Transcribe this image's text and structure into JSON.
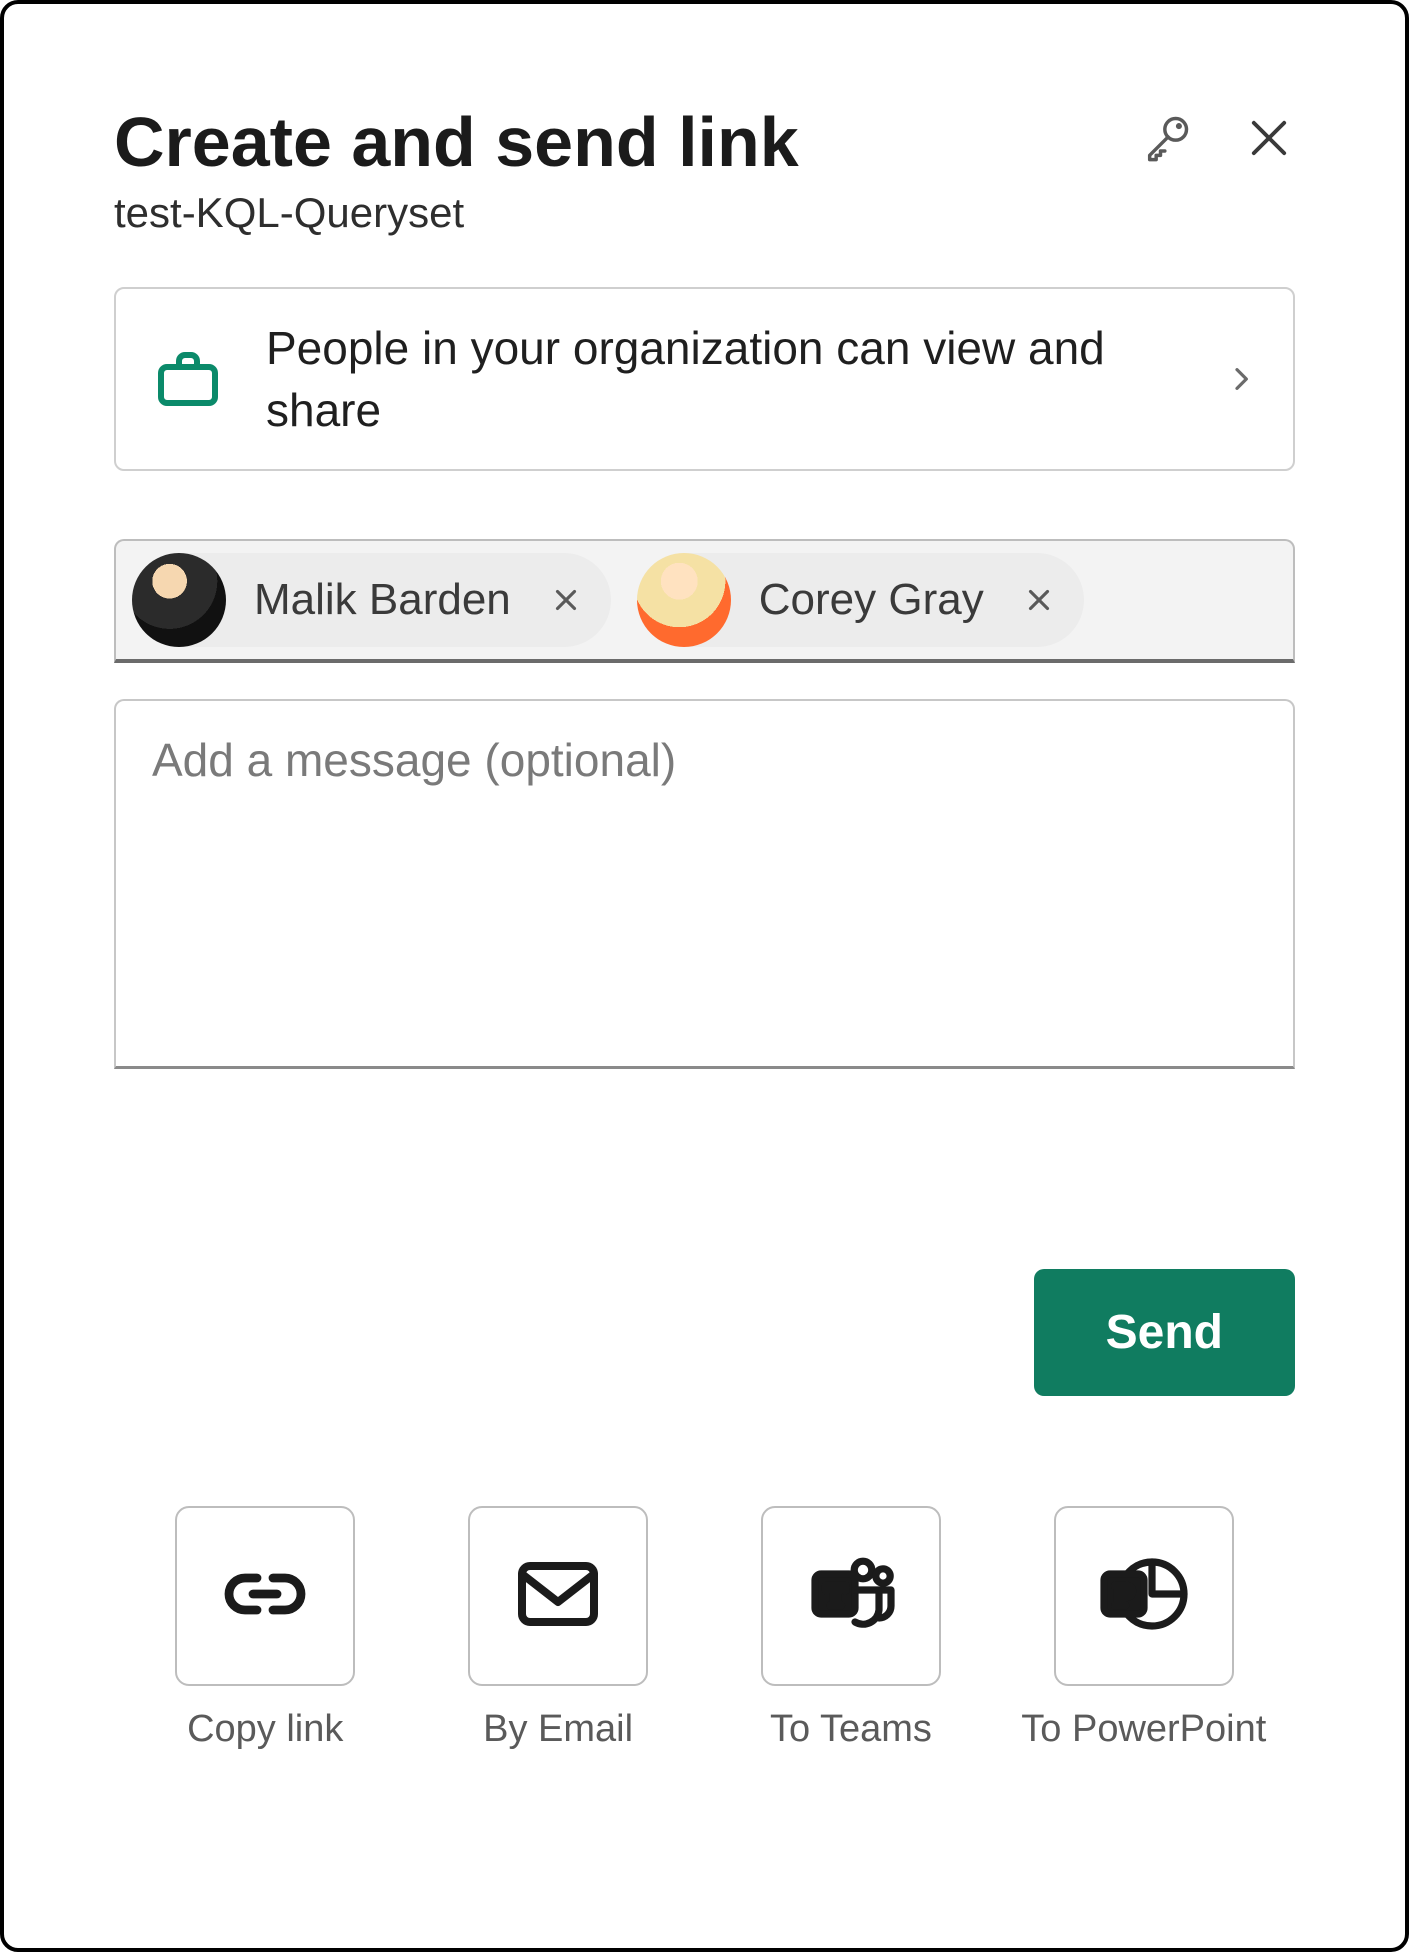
{
  "header": {
    "title": "Create and send link",
    "subtitle": "test-KQL-Queryset"
  },
  "permission": {
    "text": "People in your organization can view and share"
  },
  "people": [
    {
      "name": "Malik Barden"
    },
    {
      "name": "Corey Gray"
    }
  ],
  "message": {
    "placeholder": "Add a message (optional)",
    "value": ""
  },
  "buttons": {
    "send": "Send"
  },
  "share_options": [
    {
      "label": "Copy link"
    },
    {
      "label": "By Email"
    },
    {
      "label": "To Teams"
    },
    {
      "label": "To PowerPoint"
    }
  ],
  "colors": {
    "accent": "#107c60"
  }
}
